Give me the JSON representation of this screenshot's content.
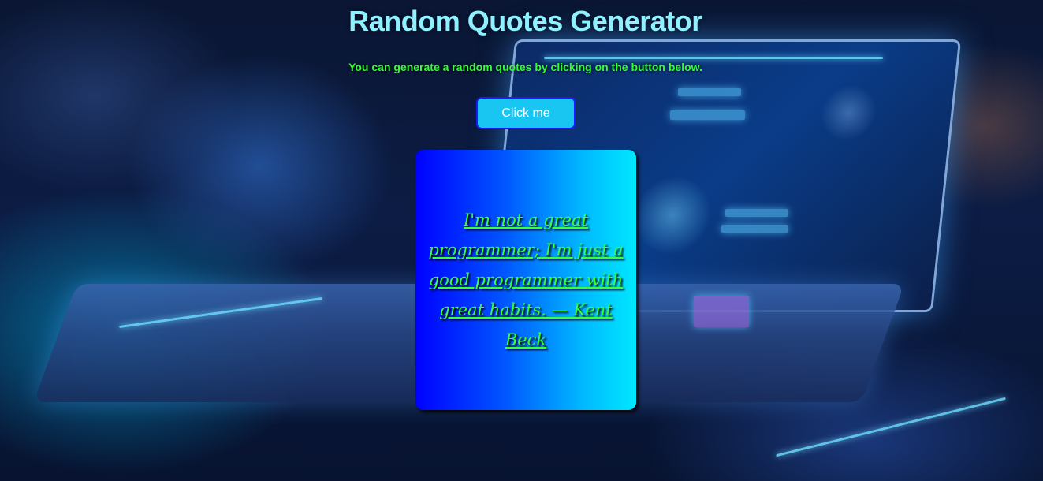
{
  "app": {
    "title": "Random Quotes Generator",
    "subtitle": "You can generate a random quotes by clicking on the button below."
  },
  "button": {
    "label": "Click me"
  },
  "quote": {
    "text": "I'm not a great programmer; I'm just a good programmer with great habits. — Kent Beck"
  },
  "colors": {
    "title": "#8ff0ff",
    "subtitle": "#33ff33",
    "button_bg": "#19c6f2",
    "button_border": "#1a1aff",
    "card_gradient_start": "#0000ff",
    "card_gradient_end": "#00e8ff",
    "quote_text": "#39ff39"
  }
}
